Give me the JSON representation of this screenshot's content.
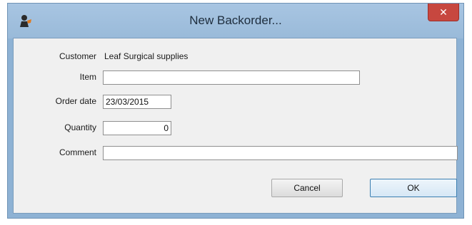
{
  "window": {
    "title": "New Backorder...",
    "close_glyph": "✕",
    "app_icon": "app-logo-icon",
    "close_icon": "close-icon"
  },
  "form": {
    "customer_label": "Customer",
    "customer_value": "Leaf Surgical supplies",
    "item_label": "Item",
    "item_value": "",
    "order_date_label": "Order date",
    "order_date_value": "23/03/2015",
    "quantity_label": "Quantity",
    "quantity_value": "0",
    "comment_label": "Comment",
    "comment_value": ""
  },
  "buttons": {
    "cancel_label": "Cancel",
    "ok_label": "OK"
  },
  "colors": {
    "frame": "#99bad9",
    "close": "#c7473f",
    "client": "#f0f0f0"
  }
}
